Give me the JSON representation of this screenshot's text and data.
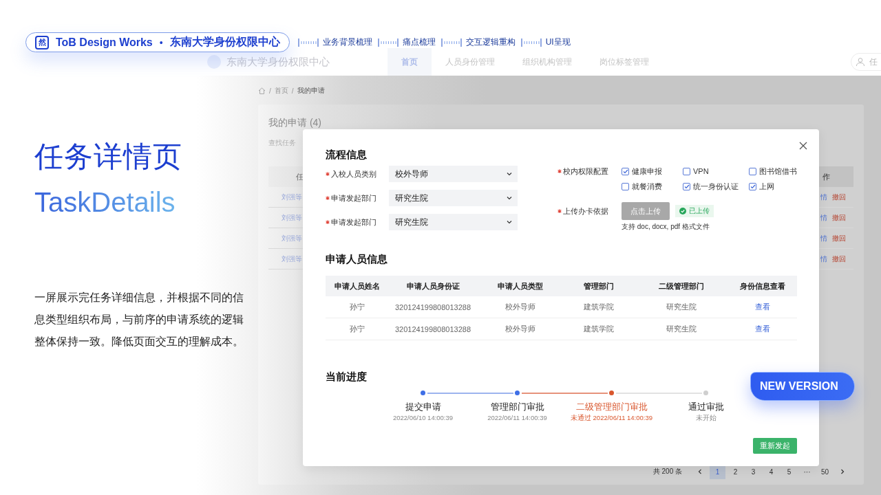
{
  "header_badge": {
    "logo": "然",
    "brand": "ToB Design Works",
    "separator": "•",
    "project": "东南大学身份权限中心"
  },
  "process_steps": [
    {
      "label": "业务背景梳理"
    },
    {
      "label": "痛点梳理"
    },
    {
      "label": "交互逻辑重构"
    },
    {
      "label": "UI呈现"
    }
  ],
  "intro": {
    "title": "任务详情页",
    "subtitle": "TaskDetails",
    "description": "一屏展示完任务详细信息，并根据不同的信息类型组织布局，与前序的申请系统的逻辑整体保持一致。降低页面交互的理解成本。"
  },
  "app": {
    "title": "东南大学身份权限中心",
    "nav_tabs": [
      {
        "label": "首页",
        "selected": true
      },
      {
        "label": "人员身份管理",
        "selected": false
      },
      {
        "label": "组织机构管理",
        "selected": false
      },
      {
        "label": "岗位标签管理",
        "selected": false
      }
    ],
    "user_label": "任",
    "breadcrumb": {
      "separator": "/",
      "items": [
        "首页",
        "我的申请"
      ]
    },
    "page_title": "我的申请 (4)",
    "search_label": "查找任务",
    "table": {
      "columns": [
        "任",
        "作"
      ],
      "rows": [
        {
          "applicant": "刘强等",
          "actions": [
            "情",
            "撤回"
          ]
        },
        {
          "applicant": "刘强等",
          "actions": [
            "情",
            "撤回"
          ]
        },
        {
          "applicant": "刘强等",
          "actions": [
            "情",
            "撤回"
          ]
        },
        {
          "applicant": "刘强等",
          "actions": [
            "情",
            "撤回"
          ]
        }
      ]
    },
    "pagination": {
      "total": "共 200 条",
      "pages": [
        {
          "label": "1",
          "selected": true
        },
        {
          "label": "2",
          "selected": false
        },
        {
          "label": "3",
          "selected": false
        },
        {
          "label": "4",
          "selected": false
        },
        {
          "label": "5",
          "selected": false
        },
        {
          "label": "···",
          "selected": false
        },
        {
          "label": "50",
          "selected": false
        }
      ]
    }
  },
  "dialog": {
    "process_info": {
      "title": "流程信息",
      "fields": [
        {
          "label": "入校人员类别",
          "required": true,
          "value": "校外导师"
        },
        {
          "label": "申请发起部门",
          "required": true,
          "value": "研究生院"
        },
        {
          "label": "申请发起部门",
          "required": true,
          "value": "研究生院"
        }
      ],
      "permissions": {
        "label": "校内权限配置",
        "required": true,
        "options": [
          {
            "label": "健康申报",
            "checked": true
          },
          {
            "label": "VPN",
            "checked": false
          },
          {
            "label": "图书馆借书",
            "checked": false
          },
          {
            "label": "就餐消费",
            "checked": false
          },
          {
            "label": "统一身份认证",
            "checked": true
          },
          {
            "label": "上网",
            "checked": true
          }
        ]
      },
      "upload": {
        "label": "上传办卡依据",
        "required": true,
        "button": "点击上传",
        "status": "已上传",
        "hint": "支持 doc, docx, pdf 格式文件"
      }
    },
    "applicants": {
      "title": "申请人员信息",
      "columns": [
        "申请人员姓名",
        "申请人员身份证",
        "申请人员类型",
        "管理部门",
        "二级管理部门",
        "身份信息查看"
      ],
      "rows": [
        {
          "name": "孙宁",
          "id_number": "320124199808013288",
          "type": "校外导师",
          "department": "建筑学院",
          "sub_department": "研究生院",
          "action": "查看"
        },
        {
          "name": "孙宁",
          "id_number": "320124199808013288",
          "type": "校外导师",
          "department": "建筑学院",
          "sub_department": "研究生院",
          "action": "查看"
        }
      ]
    },
    "progress": {
      "title": "当前进度",
      "steps": [
        {
          "label": "提交申请",
          "kind": "done",
          "detail": "2022/06/10 14:00:39"
        },
        {
          "label": "管理部门审批",
          "kind": "done",
          "detail": "2022/06/11 14:00:39"
        },
        {
          "label": "二级管理部门审批",
          "kind": "rejected",
          "detail": "未通过 2022/06/11 14:00:39"
        },
        {
          "label": "通过审批",
          "kind": "pending",
          "detail": "未开始"
        }
      ]
    },
    "resubmit": "重新发起"
  },
  "version_badge": "NEW VERSION"
}
